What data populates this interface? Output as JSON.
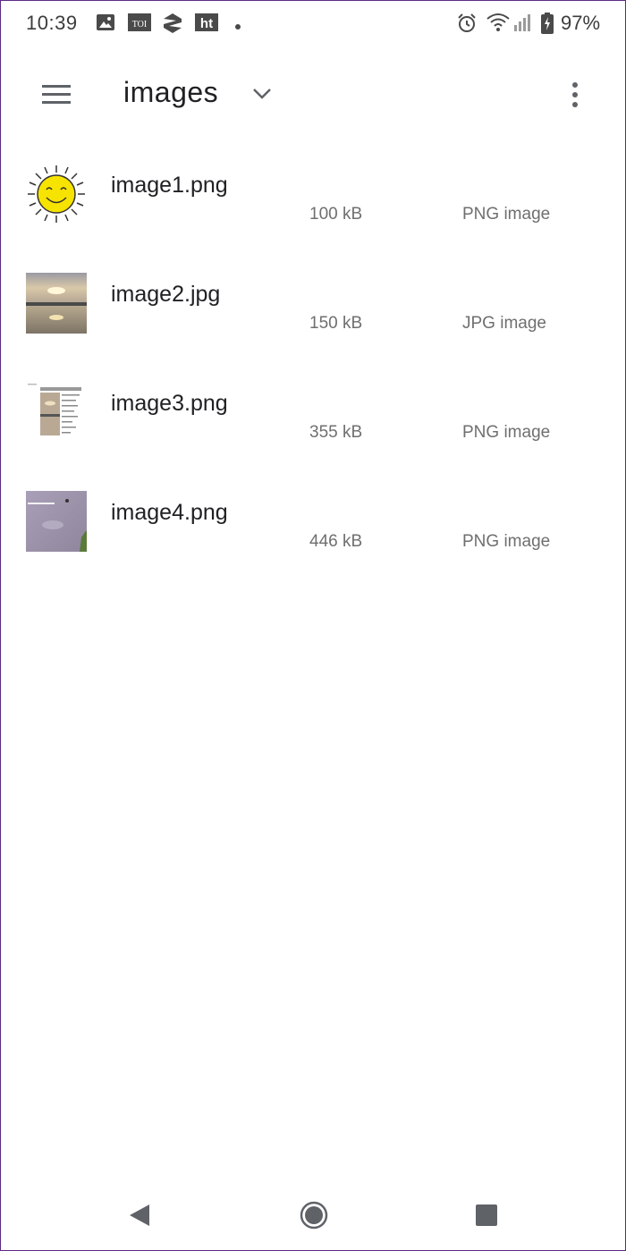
{
  "status_bar": {
    "time": "10:39",
    "notification_icons": [
      "gallery-icon",
      "toi-icon",
      "s-app-icon",
      "ht-icon",
      "dot-icon"
    ],
    "toi_label": "TOI",
    "ht_label": "ht",
    "system_icons": [
      "alarm-icon",
      "wifi-icon",
      "signal-icon",
      "battery-icon"
    ],
    "battery_percent": "97%"
  },
  "app_bar": {
    "title": "images",
    "menu_icon": "hamburger-menu-icon",
    "dropdown_icon": "chevron-down-icon",
    "overflow_icon": "more-vert-icon"
  },
  "files": [
    {
      "name": "image1.png",
      "size": "100 kB",
      "type": "PNG image",
      "thumbnail": "sun-smiley-thumbnail"
    },
    {
      "name": "image2.jpg",
      "size": "150 kB",
      "type": "JPG image",
      "thumbnail": "sunset-lake-thumbnail"
    },
    {
      "name": "image3.png",
      "size": "355 kB",
      "type": "PNG image",
      "thumbnail": "screenshot-thumbnail"
    },
    {
      "name": "image4.png",
      "size": "446 kB",
      "type": "PNG image",
      "thumbnail": "lavender-sky-thumbnail"
    }
  ],
  "nav_bar": {
    "back_icon": "back-triangle-icon",
    "home_icon": "home-circle-icon",
    "recents_icon": "recents-square-icon"
  },
  "colors": {
    "text_primary": "#202124",
    "text_secondary": "#6f6f6f",
    "icon_gray": "#5f6368",
    "sun_yellow": "#f7e300"
  }
}
